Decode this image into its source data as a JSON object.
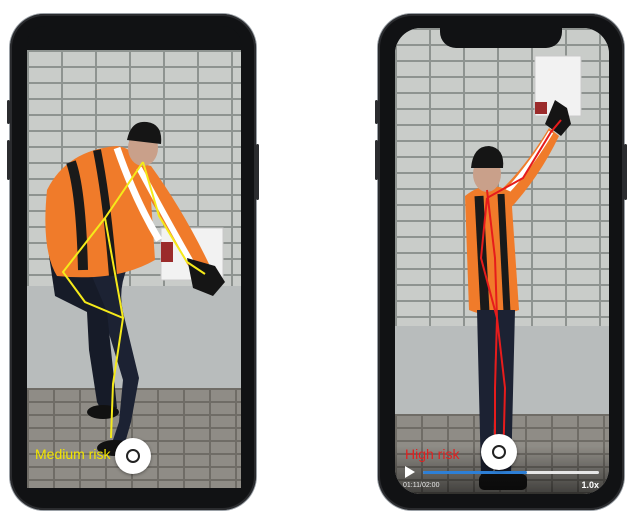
{
  "left_phone": {
    "risk_label": "Medium risk",
    "risk_color": "#f2e600",
    "skeleton_color": "#f5ea1a",
    "camera_icon": "camera-shutter-icon"
  },
  "right_phone": {
    "risk_label": "High risk",
    "risk_color": "#e02020",
    "skeleton_color": "#e61c1c",
    "camera_icon": "camera-shutter-icon",
    "player": {
      "time": "01:11/02:00",
      "speed": "1.0x",
      "progress": 0.59,
      "accent": "#2d7fd6"
    }
  }
}
